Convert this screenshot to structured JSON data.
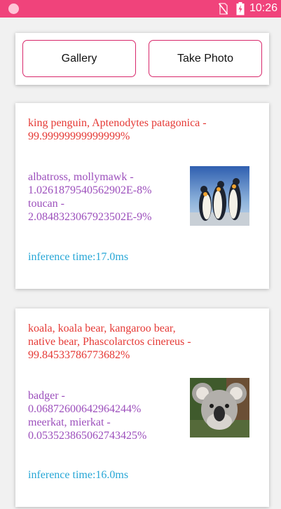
{
  "status_bar": {
    "time": "10:26",
    "color": "#f0437b",
    "icons": [
      "notification-dot-icon",
      "no-sim-icon",
      "battery-charging-icon"
    ]
  },
  "toolbar": {
    "gallery_label": "Gallery",
    "photo_label": "Take Photo",
    "accent": "#d8286b"
  },
  "results": [
    {
      "top": "king penguin, Aptenodytes patagonica   -\n99.99999999999999%",
      "others": "albatross, mollymawk   -\n1.0261879540562902E-8%\ntoucan   -\n2.0848323067923502E-9%",
      "inference": "inference time:17.0ms",
      "image": "king-penguins-image"
    },
    {
      "top": "koala, koala bear, kangaroo bear,\nnative bear, Phascolarctos cinereus   -\n99.84533786773682%",
      "others": "badger   -\n0.06872600642964244%\nmeerkat, mierkat   -\n0.053523865062743425%",
      "inference": "inference time:16.0ms",
      "image": "koala-image"
    }
  ],
  "colors": {
    "top_result": "#e53935",
    "other_results": "#9c4fbc",
    "inference": "#26a6d6"
  }
}
